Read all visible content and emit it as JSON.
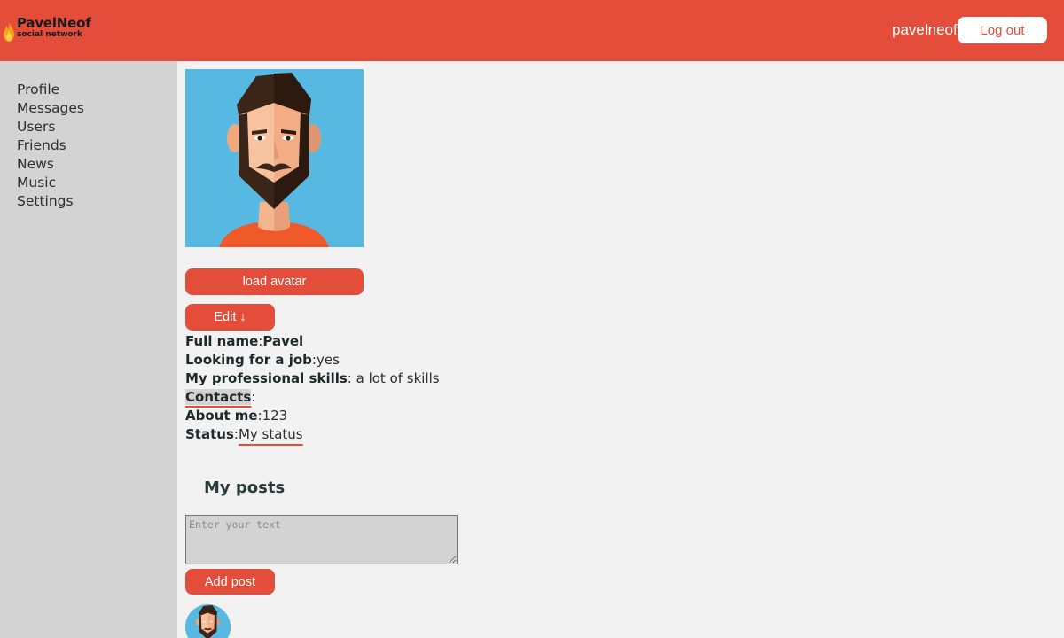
{
  "header": {
    "logo_title": "PavelNeof",
    "logo_subtitle": "social network",
    "username": "pavelneof",
    "logout_label": "Log out",
    "accent": "#e34d3a"
  },
  "sidebar": {
    "items": [
      {
        "label": "Profile"
      },
      {
        "label": "Messages"
      },
      {
        "label": "Users"
      },
      {
        "label": "Friends"
      },
      {
        "label": "News"
      },
      {
        "label": "Music"
      },
      {
        "label": "Settings"
      }
    ]
  },
  "profile": {
    "load_avatar_label": "load avatar",
    "edit_label": "Edit ↓",
    "full_name_key": "Full name",
    "full_name_value": "Pavel",
    "job_key": "Looking for a job",
    "job_value": "yes",
    "skills_key": "My professional skills",
    "skills_value": " a lot of skills",
    "contacts_key": "Contacts",
    "about_key": "About me",
    "about_value": "123",
    "status_key": "Status",
    "status_value": "My status"
  },
  "posts": {
    "title": "My posts",
    "placeholder": "Enter your text",
    "add_label": "Add post"
  },
  "icons": {
    "logo": "flame-icon",
    "avatar": "bearded-man-avatar"
  }
}
